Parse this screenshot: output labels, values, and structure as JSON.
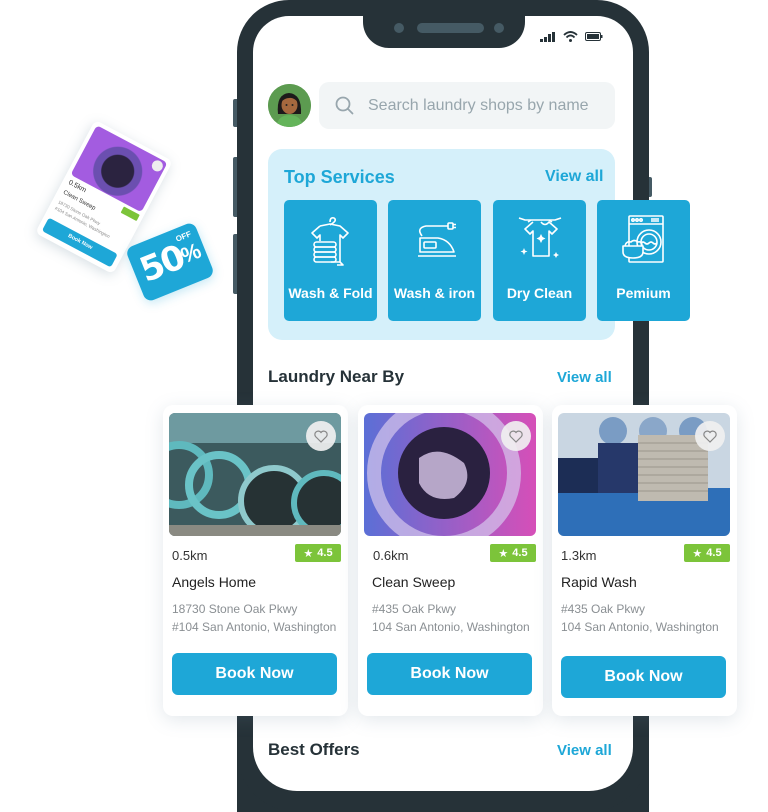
{
  "search": {
    "placeholder": "Search laundry shops by name"
  },
  "top_services": {
    "title": "Top Services",
    "view_all": "View all",
    "items": [
      {
        "label": "Wash & Fold",
        "icon": "shirt-stack-icon"
      },
      {
        "label": "Wash & iron",
        "icon": "iron-icon"
      },
      {
        "label": "Dry Clean",
        "icon": "hanging-shirt-icon"
      },
      {
        "label": "Pemium",
        "icon": "washing-machine-icon"
      }
    ]
  },
  "nearby": {
    "title": "Laundry Near By",
    "view_all": "View all",
    "shops": [
      {
        "distance": "0.5km",
        "rating": "4.5",
        "name": "Angels Home",
        "address_line1": "18730 Stone Oak Pkwy",
        "address_line2": "#104 San Antonio, Washington",
        "button": "Book Now"
      },
      {
        "distance": "0.6km",
        "rating": "4.5",
        "name": "Clean Sweep",
        "address_line1": "#435 Oak Pkwy",
        "address_line2": "104 San Antonio, Washington",
        "button": "Book Now"
      },
      {
        "distance": "1.3km",
        "rating": "4.5",
        "name": "Rapid Wash",
        "address_line1": "#435 Oak Pkwy",
        "address_line2": "104 San Antonio, Washington",
        "button": "Book Now"
      }
    ]
  },
  "best_offers": {
    "title": "Best Offers",
    "view_all": "View all"
  },
  "promo": {
    "mini_card": {
      "distance": "0.5km",
      "name": "Clean Sweep",
      "address_line1": "18730 Stone Oak Pkwy",
      "address_line2": "#104 San Antonio, Washington",
      "button": "Book Now",
      "rating": "4.5"
    },
    "badge": {
      "value": "50",
      "sign": "%",
      "label": "OFF"
    }
  },
  "colors": {
    "accent": "#1ea7d7",
    "panel": "#d5f0fa",
    "rating": "#7cc43a",
    "phone": "#263238"
  }
}
